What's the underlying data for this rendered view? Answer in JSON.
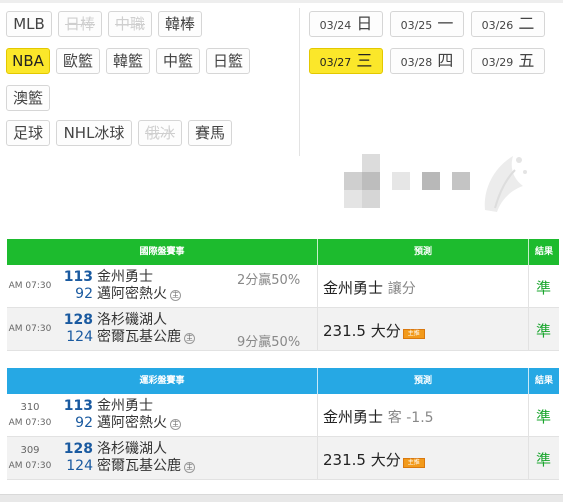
{
  "categories": [
    {
      "label": "MLB",
      "state": "normal"
    },
    {
      "label": "日棒",
      "state": "disabled"
    },
    {
      "label": "中職",
      "state": "disabled"
    },
    {
      "label": "韓棒",
      "state": "normal"
    },
    {
      "label": "NBA",
      "state": "active"
    },
    {
      "label": "歐籃",
      "state": "normal"
    },
    {
      "label": "韓籃",
      "state": "normal"
    },
    {
      "label": "中籃",
      "state": "normal"
    },
    {
      "label": "日籃",
      "state": "normal"
    },
    {
      "label": "澳籃",
      "state": "normal"
    },
    {
      "label": "足球",
      "state": "normal"
    },
    {
      "label": "NHL冰球",
      "state": "normal"
    },
    {
      "label": "俄冰",
      "state": "disabled"
    },
    {
      "label": "賽馬",
      "state": "normal"
    }
  ],
  "dates": [
    {
      "md": "03/24",
      "wd": "日",
      "state": "normal"
    },
    {
      "md": "03/25",
      "wd": "一",
      "state": "normal"
    },
    {
      "md": "03/26",
      "wd": "二",
      "state": "normal"
    },
    {
      "md": "03/27",
      "wd": "三",
      "state": "active"
    },
    {
      "md": "03/28",
      "wd": "四",
      "state": "normal"
    },
    {
      "md": "03/29",
      "wd": "五",
      "state": "normal"
    }
  ],
  "colors": {
    "accent_yellow": "#fbe72a",
    "header_green": "#1dbb2e",
    "header_blue": "#26a8e4",
    "score_blue": "#1a5aa0",
    "result_green": "#1aa52e",
    "tag_orange": "#f29a1b"
  },
  "table1": {
    "headers": {
      "match": "國際盤賽事",
      "prediction": "預測",
      "result": "結果"
    },
    "rows": [
      {
        "time": "AM 07:30",
        "top": {
          "score": "113",
          "team": "金州勇士",
          "handicap": "2分贏50%"
        },
        "bottom": {
          "score": "92",
          "team": "邁阿密熱火",
          "home": "主",
          "handicap": ""
        },
        "prediction": {
          "pick": "金州勇士",
          "note": "讓分",
          "tag": ""
        },
        "result": "準"
      },
      {
        "time": "AM 07:30",
        "top": {
          "score": "128",
          "team": "洛杉磯湖人",
          "handicap": ""
        },
        "bottom": {
          "score": "124",
          "team": "密爾瓦基公鹿",
          "home": "主",
          "handicap": "9分贏50%"
        },
        "prediction": {
          "pick": "231.5 大分",
          "note": "",
          "tag": "主推"
        },
        "result": "準"
      }
    ]
  },
  "table2": {
    "headers": {
      "match": "運彩盤賽事",
      "prediction": "預測",
      "result": "結果"
    },
    "rows": [
      {
        "id": "310",
        "time": "AM 07:30",
        "top": {
          "score": "113",
          "team": "金州勇士"
        },
        "bottom": {
          "score": "92",
          "team": "邁阿密熱火",
          "home": "主"
        },
        "prediction": {
          "pick": "金州勇士",
          "note": "客 -1.5",
          "tag": ""
        },
        "result": "準"
      },
      {
        "id": "309",
        "time": "AM 07:30",
        "top": {
          "score": "128",
          "team": "洛杉磯湖人"
        },
        "bottom": {
          "score": "124",
          "team": "密爾瓦基公鹿",
          "home": "主"
        },
        "prediction": {
          "pick": "231.5 大分",
          "note": "",
          "tag": "主推"
        },
        "result": "準"
      }
    ]
  }
}
